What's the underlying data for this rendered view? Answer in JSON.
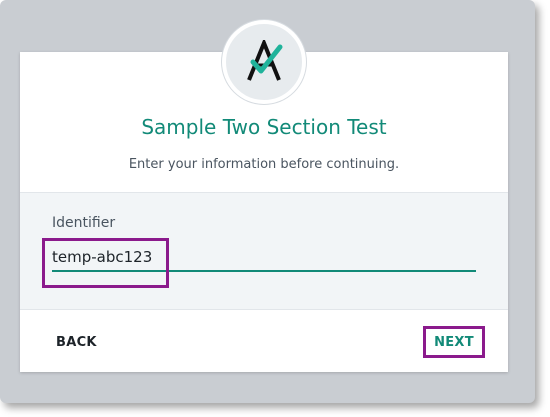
{
  "dialog": {
    "title": "Sample Two Section Test",
    "subtitle": "Enter your information before continuing."
  },
  "form": {
    "identifier_label": "Identifier",
    "identifier_value": "temp-abc123"
  },
  "buttons": {
    "back_label": "BACK",
    "next_label": "NEXT"
  },
  "colors": {
    "accent": "#128a78",
    "highlight": "#8b1a8c"
  },
  "icons": {
    "logo": "a-check-logo-icon"
  }
}
